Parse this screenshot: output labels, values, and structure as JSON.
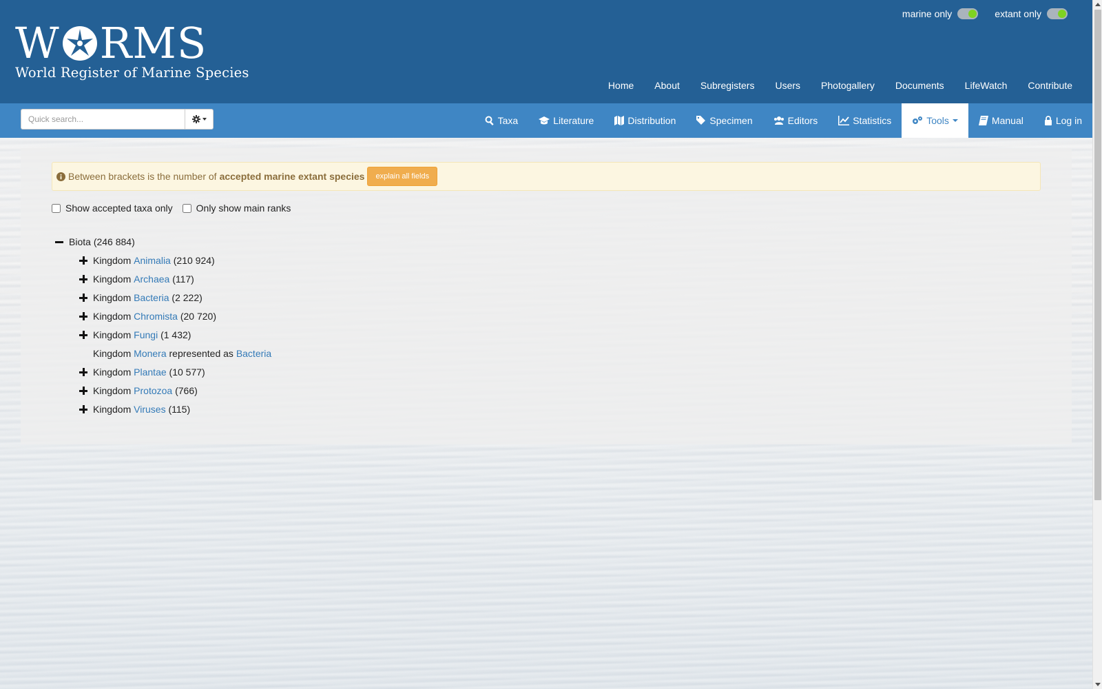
{
  "logo": {
    "title_left": "W",
    "title_right": "RMS",
    "subtitle": "World Register of Marine Species"
  },
  "toggles": [
    {
      "label": "marine only",
      "on": true
    },
    {
      "label": "extant only",
      "on": true
    }
  ],
  "topnav": [
    "Home",
    "About",
    "Subregisters",
    "Users",
    "Photogallery",
    "Documents",
    "LifeWatch",
    "Contribute"
  ],
  "search": {
    "placeholder": "Quick search..."
  },
  "mainnav": [
    {
      "label": "Taxa",
      "icon": "search-icon"
    },
    {
      "label": "Literature",
      "icon": "graduation-cap-icon"
    },
    {
      "label": "Distribution",
      "icon": "map-icon"
    },
    {
      "label": "Specimen",
      "icon": "tags-icon"
    },
    {
      "label": "Editors",
      "icon": "users-icon"
    },
    {
      "label": "Statistics",
      "icon": "line-chart-icon"
    },
    {
      "label": "Tools",
      "icon": "cogs-icon",
      "active": true
    },
    {
      "label": "Manual",
      "icon": "book-icon"
    },
    {
      "label": "Log in",
      "icon": "lock-icon"
    }
  ],
  "info": {
    "text": "Between brackets is the number of",
    "bold": "accepted marine extant species",
    "button": "explain all fields"
  },
  "filters": {
    "accepted_only": "Show accepted taxa only",
    "main_ranks": "Only show main ranks"
  },
  "tree": {
    "root": {
      "name": "Biota",
      "count": "(246 884)"
    },
    "rank_label": "Kingdom",
    "kingdoms": [
      {
        "name": "Animalia",
        "count": "(210 924)",
        "expandable": true
      },
      {
        "name": "Archaea",
        "count": "(117)",
        "expandable": true
      },
      {
        "name": "Bacteria",
        "count": "(2 222)",
        "expandable": true
      },
      {
        "name": "Chromista",
        "count": "(20 720)",
        "expandable": true
      },
      {
        "name": "Fungi",
        "count": "(1 432)",
        "expandable": true
      },
      {
        "name": "Monera",
        "note": "represented as",
        "ref": "Bacteria",
        "expandable": false
      },
      {
        "name": "Plantae",
        "count": "(10 577)",
        "expandable": true
      },
      {
        "name": "Protozoa",
        "count": "(766)",
        "expandable": true
      },
      {
        "name": "Viruses",
        "count": "(115)",
        "expandable": true
      }
    ]
  },
  "colors": {
    "header": "#246095",
    "navbar": "#3f86c4",
    "link": "#337ab7",
    "warning_button": "#f0ad4e",
    "info_bg": "#fcf6e1"
  }
}
